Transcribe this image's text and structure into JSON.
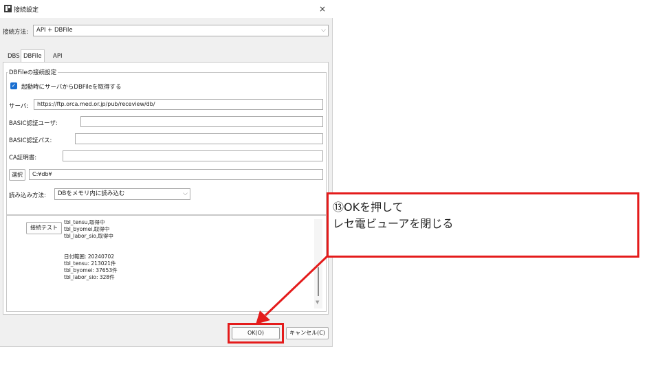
{
  "window": {
    "title": "接続設定",
    "close_glyph": "×"
  },
  "connection_method": {
    "label": "接続方法:",
    "value": "API + DBFile"
  },
  "tabs": [
    {
      "label": "DBS",
      "active": false
    },
    {
      "label": "DBFile",
      "active": true
    },
    {
      "label": "API",
      "active": false
    }
  ],
  "dbfile_group": {
    "title": "DBFileの接続設定",
    "fetch_on_start": {
      "label": "起動時にサーバからDBFileを取得する",
      "checked": true
    },
    "server": {
      "label": "サーバ:",
      "value": "https://ftp.orca.med.or.jp/pub/receview/db/"
    },
    "basic_user": {
      "label": "BASIC認証ユーザ:",
      "value": ""
    },
    "basic_pass": {
      "label": "BASIC認証パス:",
      "value": ""
    },
    "ca_cert": {
      "label": "CA証明書:",
      "value": ""
    },
    "select_button": "選択",
    "path_value": "C:¥db¥",
    "load_method": {
      "label": "読み込み方法:",
      "value": "DBをメモリ内に読み込む"
    }
  },
  "test": {
    "button_label": "接続テスト",
    "log_lines": [
      "tbl_tensu,取得中",
      "tbl_byomei,取得中",
      "tbl_labor_sio,取得中",
      "",
      "",
      "日付範囲: 20240702",
      "tbl_tensu: 213021件",
      "tbl_byomei: 37653件",
      "tbl_labor_sio: 328件"
    ]
  },
  "footer": {
    "ok_label": "OK(O)",
    "cancel_label": "キャンセル(C)"
  },
  "annotation": {
    "line1": "⑬OKを押して",
    "line2": "レセ電ビューアを閉じる",
    "color": "#e41b1b"
  }
}
